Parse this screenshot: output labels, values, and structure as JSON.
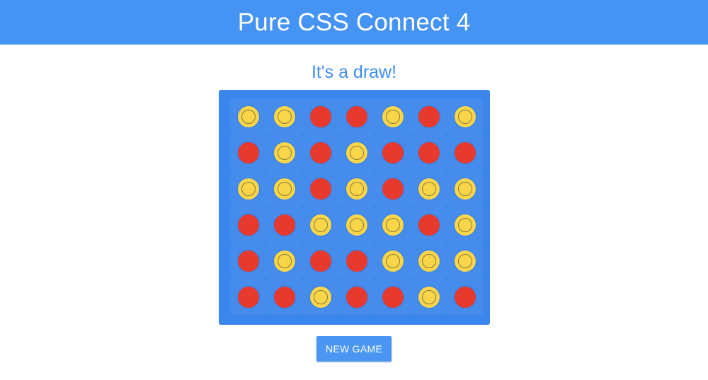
{
  "header": {
    "title": "Pure CSS Connect 4"
  },
  "status": {
    "message": "It's a draw!"
  },
  "board": {
    "rows": [
      [
        "yellow",
        "yellow",
        "red",
        "red",
        "yellow",
        "red",
        "yellow"
      ],
      [
        "red",
        "yellow",
        "red",
        "yellow",
        "red",
        "red",
        "red"
      ],
      [
        "yellow",
        "yellow",
        "red",
        "yellow",
        "red",
        "yellow",
        "yellow"
      ],
      [
        "red",
        "red",
        "yellow",
        "yellow",
        "yellow",
        "red",
        "yellow"
      ],
      [
        "red",
        "yellow",
        "red",
        "red",
        "yellow",
        "yellow",
        "yellow"
      ],
      [
        "red",
        "red",
        "yellow",
        "red",
        "red",
        "yellow",
        "red"
      ]
    ]
  },
  "controls": {
    "new_game_label": "NEW GAME"
  },
  "colors": {
    "header": "#4593f2",
    "board": "#3b86ec",
    "red_disc": "#e8392e",
    "yellow_disc": "#f9d54a",
    "status_text": "#3f8ef0"
  }
}
